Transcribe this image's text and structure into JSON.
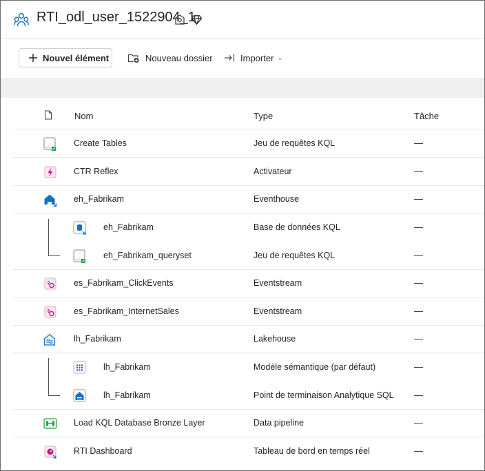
{
  "workspace": {
    "title": "RTI_odl_user_1522904_1"
  },
  "toolbar": {
    "new_item": "Nouvel élément",
    "new_folder": "Nouveau dossier",
    "import": "Importer"
  },
  "table": {
    "columns": {
      "name": "Nom",
      "type": "Type",
      "task": "Tâche"
    },
    "rows": [
      {
        "name": "Create Tables",
        "type": "Jeu de requêtes KQL",
        "task": "—",
        "icon": "kql-queryset-icon"
      },
      {
        "name": "CTR Reflex",
        "type": "Activateur",
        "task": "—",
        "icon": "activator-icon"
      },
      {
        "name": "eh_Fabrikam",
        "type": "Eventhouse",
        "task": "—",
        "icon": "eventhouse-icon"
      },
      {
        "name": "eh_Fabrikam",
        "type": "Base de données KQL",
        "task": "—",
        "icon": "kql-database-icon"
      },
      {
        "name": "eh_Fabrikam_queryset",
        "type": "Jeu de requêtes KQL",
        "task": "—",
        "icon": "kql-queryset-icon"
      },
      {
        "name": "es_Fabrikam_ClickEvents",
        "type": "Eventstream",
        "task": "—",
        "icon": "eventstream-icon"
      },
      {
        "name": "es_Fabrikam_InternetSales",
        "type": "Eventstream",
        "task": "—",
        "icon": "eventstream-icon"
      },
      {
        "name": "lh_Fabrikam",
        "type": "Lakehouse",
        "task": "—",
        "icon": "lakehouse-icon"
      },
      {
        "name": "lh_Fabrikam",
        "type": "Modèle sémantique (par défaut)",
        "task": "—",
        "icon": "semantic-model-icon"
      },
      {
        "name": "lh_Fabrikam",
        "type": "Point de terminaison Analytique SQL",
        "task": "—",
        "icon": "sql-endpoint-icon"
      },
      {
        "name": "Load KQL Database Bronze Layer",
        "type": "Data pipeline",
        "task": "—",
        "icon": "data-pipeline-icon"
      },
      {
        "name": "RTI Dashboard",
        "type": "Tableau de bord en temps réel",
        "task": "—",
        "icon": "realtime-dashboard-icon"
      }
    ]
  }
}
